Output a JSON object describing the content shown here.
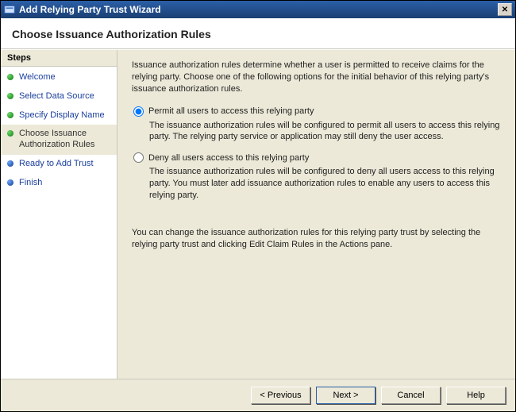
{
  "window": {
    "title": "Add Relying Party Trust Wizard",
    "close_label": "✕"
  },
  "heading": "Choose Issuance Authorization Rules",
  "sidebar": {
    "header": "Steps",
    "items": [
      {
        "label": "Welcome",
        "state": "done"
      },
      {
        "label": "Select Data Source",
        "state": "done"
      },
      {
        "label": "Specify Display Name",
        "state": "done"
      },
      {
        "label": "Choose Issuance Authorization Rules",
        "state": "current"
      },
      {
        "label": "Ready to Add Trust",
        "state": "todo"
      },
      {
        "label": "Finish",
        "state": "todo"
      }
    ]
  },
  "main": {
    "intro": "Issuance authorization rules determine whether a user is permitted to receive claims for the relying party. Choose one of the following options for the initial behavior of this relying party's issuance authorization rules.",
    "option1": {
      "label": "Permit all users to access this relying party",
      "desc": "The issuance authorization rules will be configured to permit all users to access this relying party. The relying party service or application may still deny the user access."
    },
    "option2": {
      "label": "Deny all users access to this relying party",
      "desc": "The issuance authorization rules will be configured to deny all users access to this relying party. You must later add issuance authorization rules to enable any users to access this relying party."
    },
    "footer_note": "You can change the issuance authorization rules for this relying party trust by selecting the relying party trust and clicking Edit Claim Rules in the Actions pane.",
    "selected": "option1"
  },
  "buttons": {
    "previous": "< Previous",
    "next": "Next >",
    "cancel": "Cancel",
    "help": "Help"
  }
}
